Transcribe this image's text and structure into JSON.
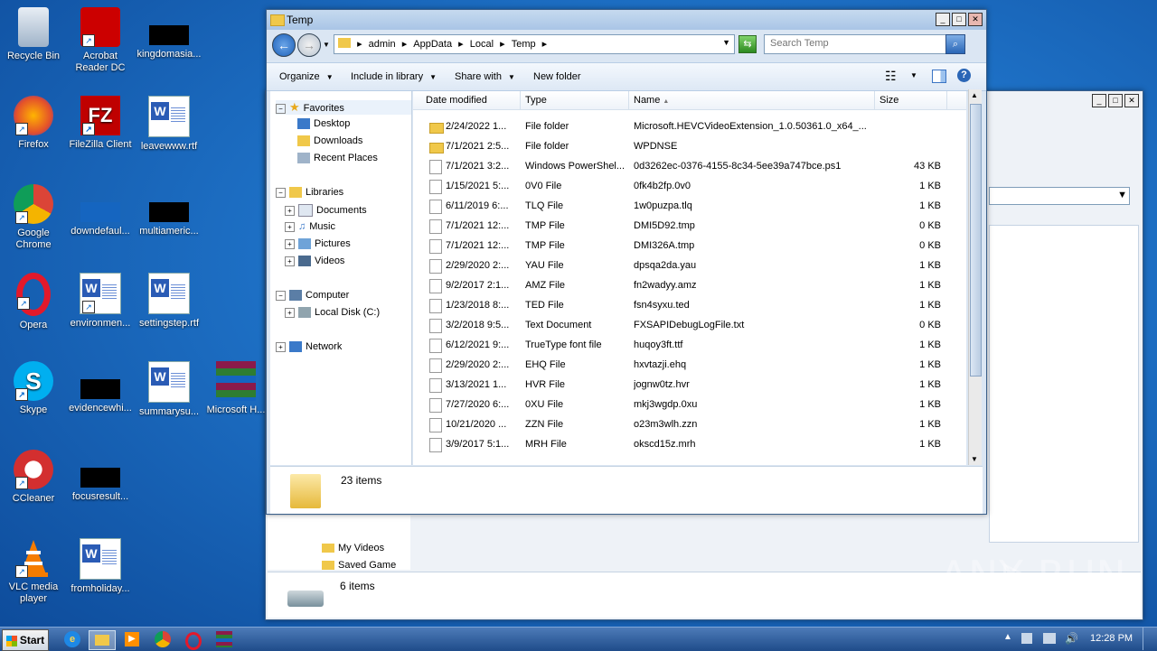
{
  "desktop": {
    "icons": [
      {
        "label": "Recycle Bin"
      },
      {
        "label": "Acrobat Reader DC"
      },
      {
        "label": "kingdomasia..."
      },
      {
        "label": "Firefox"
      },
      {
        "label": "FileZilla Client"
      },
      {
        "label": "leavewww.rtf"
      },
      {
        "label": "Google Chrome"
      },
      {
        "label": "downdefaul..."
      },
      {
        "label": "multiameric..."
      },
      {
        "label": "Opera"
      },
      {
        "label": "environmen..."
      },
      {
        "label": "settingstep.rtf"
      },
      {
        "label": "Skype"
      },
      {
        "label": "evidencewhi..."
      },
      {
        "label": "summarysu..."
      },
      {
        "label": "Microsoft H..."
      },
      {
        "label": "CCleaner"
      },
      {
        "label": "focusresult..."
      },
      {
        "label": "VLC media player"
      },
      {
        "label": "fromholiday..."
      }
    ]
  },
  "window": {
    "title": "Temp",
    "breadcrumb": [
      "admin",
      "AppData",
      "Local",
      "Temp"
    ],
    "search_placeholder": "Search Temp",
    "toolbar": {
      "organize": "Organize",
      "include": "Include in library",
      "share": "Share with",
      "new_folder": "New folder"
    },
    "nav": {
      "favorites": "Favorites",
      "desktop": "Desktop",
      "downloads": "Downloads",
      "recent": "Recent Places",
      "libraries": "Libraries",
      "documents": "Documents",
      "music": "Music",
      "pictures": "Pictures",
      "videos": "Videos",
      "computer": "Computer",
      "local_disk": "Local Disk (C:)",
      "network": "Network"
    },
    "columns": {
      "date": "Date modified",
      "type": "Type",
      "name": "Name",
      "size": "Size"
    },
    "files": [
      {
        "date": "2/24/2022 1...",
        "type": "File folder",
        "name": "Microsoft.HEVCVideoExtension_1.0.50361.0_x64_...",
        "size": ""
      },
      {
        "date": "7/1/2021 2:5...",
        "type": "File folder",
        "name": "WPDNSE",
        "size": ""
      },
      {
        "date": "7/1/2021 3:2...",
        "type": "Windows PowerShel...",
        "name": "0d3262ec-0376-4155-8c34-5ee39a747bce.ps1",
        "size": "43 KB"
      },
      {
        "date": "1/15/2021 5:...",
        "type": "0V0 File",
        "name": "0fk4b2fp.0v0",
        "size": "1 KB"
      },
      {
        "date": "6/11/2019 6:...",
        "type": "TLQ File",
        "name": "1w0puzpa.tlq",
        "size": "1 KB"
      },
      {
        "date": "7/1/2021 12:...",
        "type": "TMP File",
        "name": "DMI5D92.tmp",
        "size": "0 KB"
      },
      {
        "date": "7/1/2021 12:...",
        "type": "TMP File",
        "name": "DMI326A.tmp",
        "size": "0 KB"
      },
      {
        "date": "2/29/2020 2:...",
        "type": "YAU File",
        "name": "dpsqa2da.yau",
        "size": "1 KB"
      },
      {
        "date": "9/2/2017 2:1...",
        "type": "AMZ File",
        "name": "fn2wadyy.amz",
        "size": "1 KB"
      },
      {
        "date": "1/23/2018 8:...",
        "type": "TED File",
        "name": "fsn4syxu.ted",
        "size": "1 KB"
      },
      {
        "date": "3/2/2018 9:5...",
        "type": "Text Document",
        "name": "FXSAPIDebugLogFile.txt",
        "size": "0 KB"
      },
      {
        "date": "6/12/2021 9:...",
        "type": "TrueType font file",
        "name": "huqoy3ft.ttf",
        "size": "1 KB"
      },
      {
        "date": "2/29/2020 2:...",
        "type": "EHQ File",
        "name": "hxvtazji.ehq",
        "size": "1 KB"
      },
      {
        "date": "3/13/2021 1...",
        "type": "HVR File",
        "name": "jognw0tz.hvr",
        "size": "1 KB"
      },
      {
        "date": "7/27/2020 6:...",
        "type": "0XU File",
        "name": "mkj3wgdp.0xu",
        "size": "1 KB"
      },
      {
        "date": "10/21/2020 ...",
        "type": "ZZN File",
        "name": "o23m3wlh.zzn",
        "size": "1 KB"
      },
      {
        "date": "3/9/2017 5:1...",
        "type": "MRH File",
        "name": "okscd15z.mrh",
        "size": "1 KB"
      }
    ],
    "status_count": "23 items"
  },
  "back_window": {
    "nav_videos": "My Videos",
    "nav_saved": "Saved Game",
    "status_count": "6 items"
  },
  "watermark": "ANY RUN",
  "taskbar": {
    "start": "Start",
    "time": "12:28 PM"
  }
}
